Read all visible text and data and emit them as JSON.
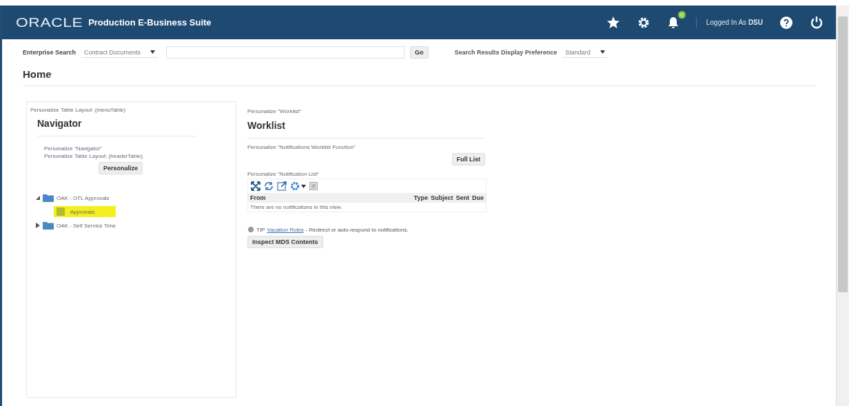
{
  "header": {
    "logo": "ORACLE",
    "title": "Production E-Business Suite",
    "notification_count": "0",
    "user_label": "Logged In As",
    "user": "DSU"
  },
  "search": {
    "label": "Enterprise Search",
    "category": "Contract Documents",
    "go": "Go",
    "preference_label": "Search Results Display Preference",
    "preference": "Standard"
  },
  "page_title": "Home",
  "navigator": {
    "personalize_layout": "Personalize Table Layout: (menuTable)",
    "title": "Navigator",
    "personalize_links": [
      "Personalize \"Navigator\"",
      "Personalize Table Layout: (headerTable)"
    ],
    "personalize_button": "Personalize",
    "tree": [
      {
        "label": "OAK - OTL Approvals",
        "expanded": true,
        "children": [
          {
            "label": "Approvals",
            "selected": true
          }
        ]
      },
      {
        "label": "OAK - Self Service Time",
        "expanded": false
      }
    ]
  },
  "worklist": {
    "personalize": "Personalize \"Worklist\"",
    "title": "Worklist",
    "personalize_function": "Personalize \"Notifications Worklist Function\"",
    "full_list": "Full List",
    "personalize_list": "Personalize \"Notification List\"",
    "columns": [
      "From",
      "Type",
      "Subject",
      "Sent",
      "Due"
    ],
    "empty": "There are no notifications in this view.",
    "tip_label": "TIP",
    "tip_link": "Vacation Rules",
    "tip_text": "- Redirect or auto-respond to notifications.",
    "inspect_button": "Inspect MDS Contents"
  }
}
